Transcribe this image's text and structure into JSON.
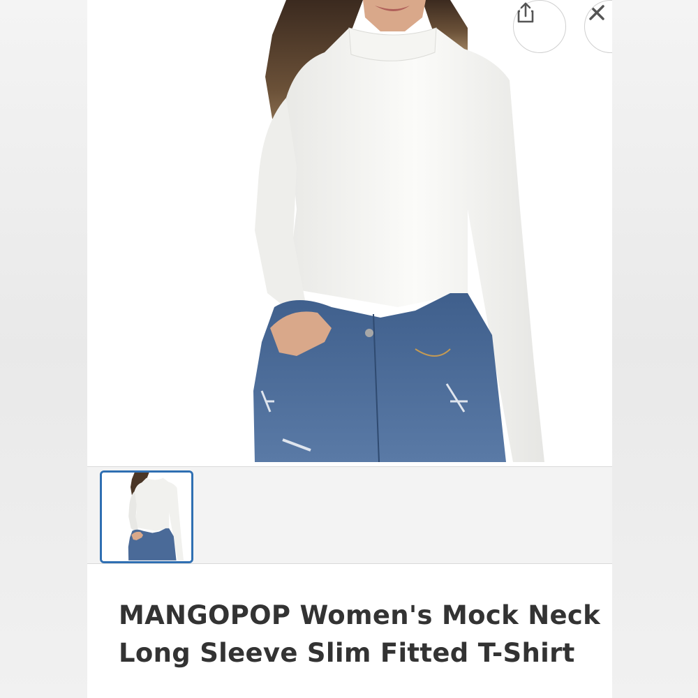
{
  "product": {
    "title": "MANGOPOP Women's Mock Neck Long Sleeve Slim Fitted T-Shirt",
    "main_image": "product-photo-white-mock-neck-top",
    "thumbnails": [
      {
        "image": "product-photo-white-mock-neck-top",
        "selected": true
      }
    ]
  },
  "actions": {
    "share_icon": "share-icon",
    "close_icon": "close-icon"
  },
  "colors": {
    "thumbnail_border": "#2f6fb2",
    "title_text": "#333333",
    "strip_background": "#f3f3f3"
  }
}
